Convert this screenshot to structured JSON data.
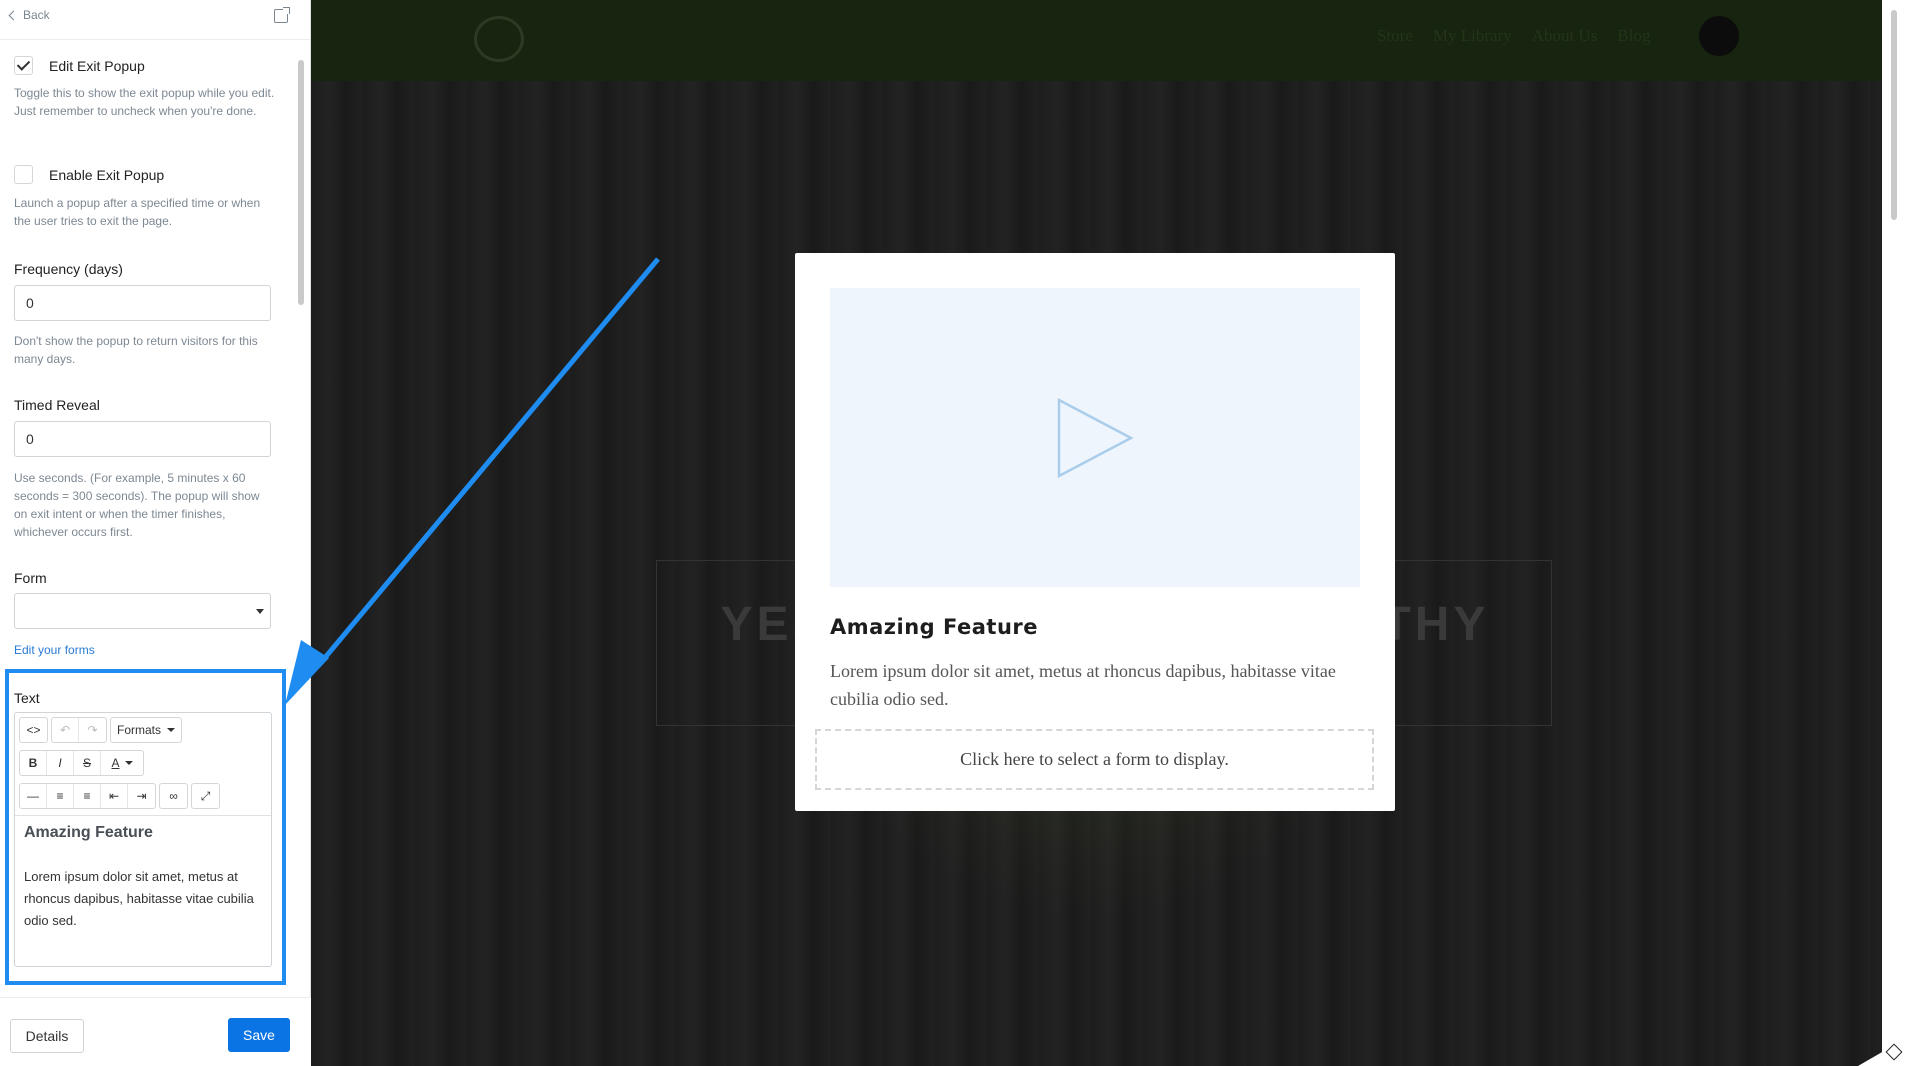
{
  "panel": {
    "back_label": "Back",
    "edit_exit_popup": {
      "label": "Edit Exit Popup",
      "checked": true,
      "help": "Toggle this to show the exit popup while you edit. Just remember to uncheck when you're done."
    },
    "enable_exit_popup": {
      "label": "Enable Exit Popup",
      "checked": false,
      "help": "Launch a popup after a specified time or when the user tries to exit the page."
    },
    "frequency": {
      "label": "Frequency (days)",
      "value": "0",
      "help": "Don't show the popup to return visitors for this many days."
    },
    "timed_reveal": {
      "label": "Timed Reveal",
      "value": "0",
      "help": "Use seconds. (For example, 5 minutes x 60 seconds = 300 seconds). The popup will show on exit intent or when the timer finishes, whichever occurs first."
    },
    "form": {
      "label": "Form",
      "value": "",
      "link": "Edit your forms"
    },
    "text": {
      "label": "Text",
      "toolbar": {
        "formats_label": "Formats",
        "bold": "B",
        "italic": "I",
        "strike": "S",
        "color": "A"
      },
      "heading": "Amazing Feature",
      "body": "Lorem ipsum dolor sit amet, metus at rhoncus dapibus, habitasse vitae cubilia odio sed."
    },
    "footer": {
      "details_label": "Details",
      "save_label": "Save"
    }
  },
  "site": {
    "nav": [
      "Store",
      "My Library",
      "About Us",
      "Blog"
    ],
    "hero_text": "YES I WANT TO BE HEALTHY"
  },
  "popup": {
    "title": "Amazing Feature",
    "body": "Lorem ipsum dolor sit amet, metus at rhoncus dapibus, habitasse vitae cubilia odio sed.",
    "form_placeholder": "Click here to select a form to display."
  },
  "colors": {
    "accent": "#0b74e5",
    "highlight": "#1e8cf0",
    "nav_bg": "#17240f",
    "video_bg": "#eef5fd"
  }
}
